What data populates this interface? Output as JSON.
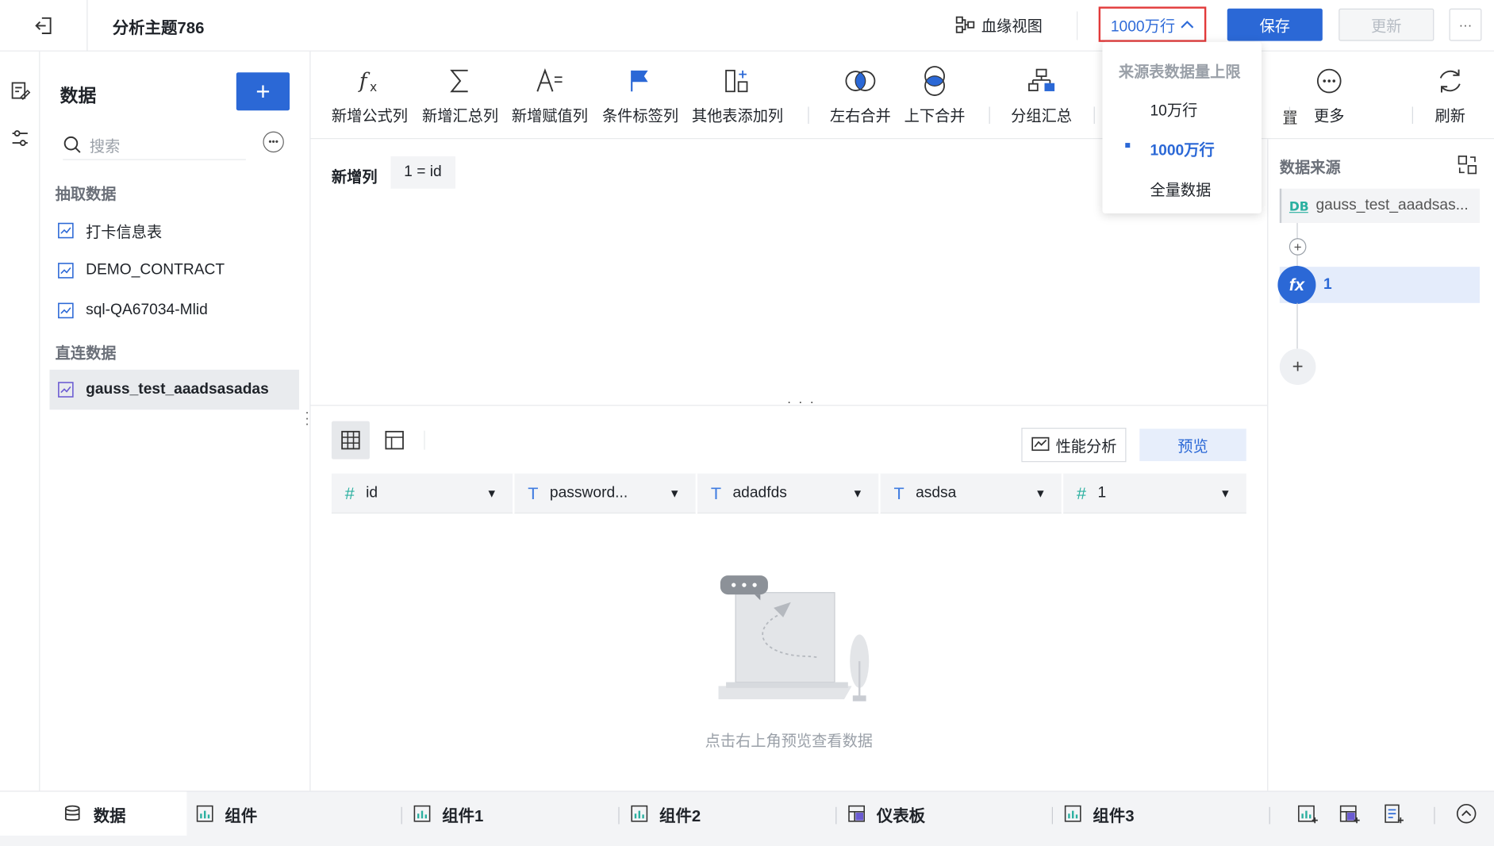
{
  "header": {
    "title": "分析主题786",
    "lineage_label": "血缘视图",
    "row_limit_label": "1000万行",
    "save_label": "保存",
    "update_label": "更新",
    "more_label": "···"
  },
  "left_panel": {
    "title": "数据",
    "add_label": "+",
    "search_placeholder": "搜索",
    "groups": [
      {
        "label": "抽取数据",
        "items": [
          "打卡信息表",
          "DEMO_CONTRACT",
          "sql-QA67034-Mlid"
        ]
      },
      {
        "label": "直连数据",
        "items": [
          "gauss_test_aaadsasadas"
        ]
      }
    ]
  },
  "toolbar": {
    "items": [
      {
        "label": "新增公式列",
        "icon": "formula-icon"
      },
      {
        "label": "新增汇总列",
        "icon": "sigma-icon"
      },
      {
        "label": "新增赋值列",
        "icon": "assign-icon"
      },
      {
        "label": "条件标签列",
        "icon": "flag-icon"
      },
      {
        "label": "其他表添加列",
        "icon": "add-column-icon"
      },
      {
        "label": "左右合并",
        "icon": "merge-lr-icon"
      },
      {
        "label": "上下合并",
        "icon": "merge-tb-icon"
      },
      {
        "label": "分组汇总",
        "icon": "group-icon"
      },
      {
        "label": "更多",
        "icon": "more-icon"
      },
      {
        "label": "刷新",
        "icon": "refresh-icon"
      }
    ],
    "hidden_fragment": "置"
  },
  "editor": {
    "label": "新增列",
    "chip": "1 = id"
  },
  "preview": {
    "perf_label": "性能分析",
    "preview_label": "预览",
    "columns": [
      {
        "type": "#",
        "name": "id"
      },
      {
        "type": "T",
        "name": "password..."
      },
      {
        "type": "T",
        "name": "adadfds"
      },
      {
        "type": "T",
        "name": "asdsa"
      },
      {
        "type": "#",
        "name": "1"
      }
    ],
    "empty_text": "点击右上角预览查看数据"
  },
  "right_panel": {
    "title": "数据来源",
    "source": "gauss_test_aaadsas...",
    "step_label": "1",
    "step_icon_text": "fx"
  },
  "dropdown": {
    "header": "来源表数据量上限",
    "options": [
      "10万行",
      "1000万行",
      "全量数据"
    ],
    "selected": "1000万行"
  },
  "bottom_tabs": [
    {
      "label": "数据",
      "icon": "database-icon"
    },
    {
      "label": "组件",
      "icon": "chart-icon"
    },
    {
      "label": "组件1",
      "icon": "chart-icon"
    },
    {
      "label": "组件2",
      "icon": "chart-icon"
    },
    {
      "label": "仪表板",
      "icon": "dashboard-icon"
    },
    {
      "label": "组件3",
      "icon": "chart-icon"
    }
  ],
  "colors": {
    "primary": "#2b68d6",
    "highlight_border": "#e23a3a",
    "numeric_type": "#2bb0a0",
    "text_type": "#3f7be0"
  }
}
